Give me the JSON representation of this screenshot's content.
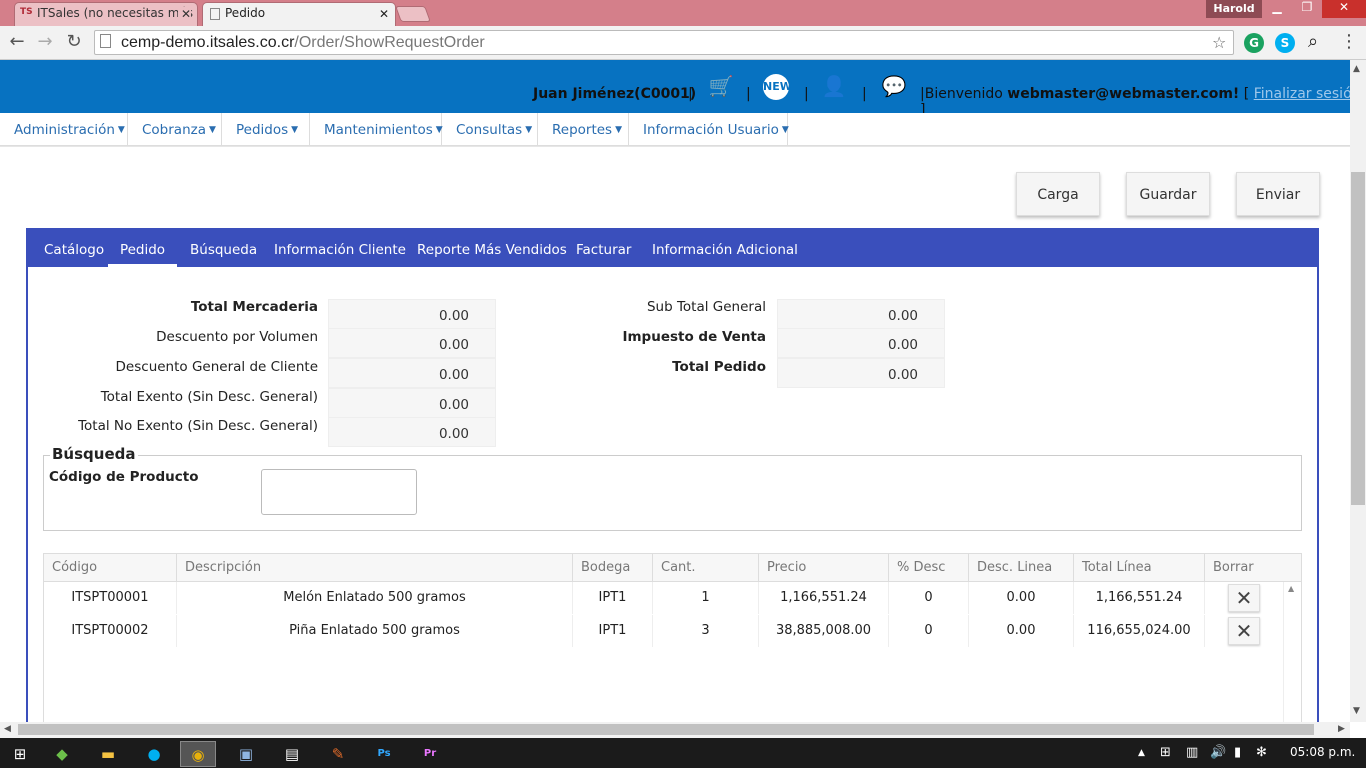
{
  "browser": {
    "tabs": [
      {
        "title": "ITSales (no necesitas más",
        "active": false
      },
      {
        "title": "Pedido",
        "active": true
      }
    ],
    "profile_name": "Harold",
    "url_host": "cemp-demo.itsales.co.cr",
    "url_path": "/Order/ShowRequestOrder"
  },
  "header": {
    "user": "Juan Jiménez(C0001)",
    "welcome_prefix": "Bienvenido",
    "email": "webmaster@webmaster.com!",
    "logout_label": "Finalizar sesión",
    "icons": [
      "cart-icon",
      "new-badge-icon",
      "user-icon",
      "chat-icon"
    ]
  },
  "menu": [
    {
      "label": "Administración"
    },
    {
      "label": "Cobranza"
    },
    {
      "label": "Pedidos"
    },
    {
      "label": "Mantenimientos"
    },
    {
      "label": "Consultas"
    },
    {
      "label": "Reportes"
    },
    {
      "label": "Información Usuario"
    }
  ],
  "actions": {
    "carga": "Carga",
    "guardar": "Guardar",
    "enviar": "Enviar"
  },
  "tabs": [
    {
      "label": "Catálogo",
      "active": false
    },
    {
      "label": "Pedido",
      "active": true
    },
    {
      "label": "Búsqueda",
      "active": false
    },
    {
      "label": "Información Cliente",
      "active": false
    },
    {
      "label": "Reporte Más Vendidos",
      "active": false
    },
    {
      "label": "Facturar",
      "active": false
    },
    {
      "label": "Información Adicional",
      "active": false
    }
  ],
  "totals_left": [
    {
      "label": "Total Mercaderia",
      "value": "0.00",
      "bold": true
    },
    {
      "label": "Descuento por Volumen",
      "value": "0.00",
      "bold": false
    },
    {
      "label": "Descuento General de Cliente",
      "value": "0.00",
      "bold": false
    },
    {
      "label": "Total Exento (Sin Desc. General)",
      "value": "0.00",
      "bold": false
    },
    {
      "label": "Total No Exento (Sin Desc. General)",
      "value": "0.00",
      "bold": false
    }
  ],
  "totals_right": [
    {
      "label": "Sub Total General",
      "value": "0.00",
      "bold": false
    },
    {
      "label": "Impuesto de Venta",
      "value": "0.00",
      "bold": true
    },
    {
      "label": "Total Pedido",
      "value": "0.00",
      "bold": true
    }
  ],
  "search": {
    "title": "Búsqueda",
    "product_code_label": "Código de Producto",
    "product_code_value": ""
  },
  "grid": {
    "columns": [
      "Código",
      "Descripción",
      "Bodega",
      "Cant.",
      "Precio",
      "% Desc",
      "Desc. Linea",
      "Total Línea",
      "Borrar"
    ],
    "rows": [
      {
        "codigo": "ITSPT00001",
        "descripcion": "Melón Enlatado 500 gramos",
        "bodega": "IPT1",
        "cant": "1",
        "precio": "1,166,551.24",
        "desc": "0",
        "desc_linea": "0.00",
        "total": "1,166,551.24"
      },
      {
        "codigo": "ITSPT00002",
        "descripcion": "Piña Enlatado 500 gramos",
        "bodega": "IPT1",
        "cant": "3",
        "precio": "38,885,008.00",
        "desc": "0",
        "desc_linea": "0.00",
        "total": "116,655,024.00"
      }
    ]
  },
  "taskbar": {
    "clock": "05:08 p.m."
  }
}
